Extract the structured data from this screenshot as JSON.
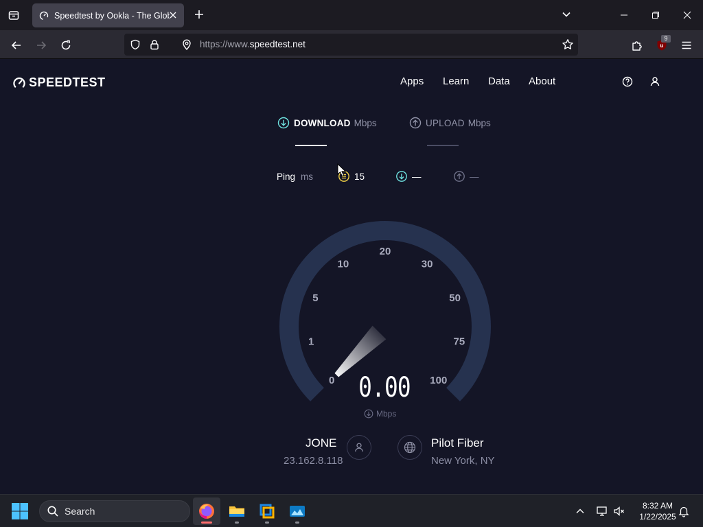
{
  "browser": {
    "tab_title": "Speedtest by Ookla - The Global Broadband Speed Test",
    "url_prefix": "https://www.",
    "url_domain": "speedtest.net",
    "ublock_count": "9"
  },
  "site": {
    "logo_text": "SPEEDTEST",
    "nav": [
      "Apps",
      "Learn",
      "Data",
      "About"
    ]
  },
  "test": {
    "download_label": "DOWNLOAD",
    "download_unit": "Mbps",
    "upload_label": "UPLOAD",
    "upload_unit": "Mbps",
    "ping_label": "Ping",
    "ping_unit": "ms",
    "ping_idle": "15",
    "ping_download": "—",
    "ping_upload": "—",
    "gauge_ticks": [
      "0",
      "1",
      "5",
      "10",
      "20",
      "30",
      "50",
      "75",
      "100"
    ],
    "speed_value": "0.00",
    "speed_unit": "Mbps",
    "gauge_fraction": 0.0
  },
  "client": {
    "isp": "JONE",
    "ip": "23.162.8.118",
    "server_name": "Pilot Fiber",
    "server_location": "New York, NY"
  },
  "taskbar": {
    "search_placeholder": "Search",
    "time": "8:32 AM",
    "date": "1/22/2025"
  },
  "colors": {
    "page_bg": "#141526",
    "gauge_track": "#26324f",
    "download_accent": "#6fe3e1",
    "ping_accent": "#f5d547",
    "upload_accent": "#9193a8"
  }
}
